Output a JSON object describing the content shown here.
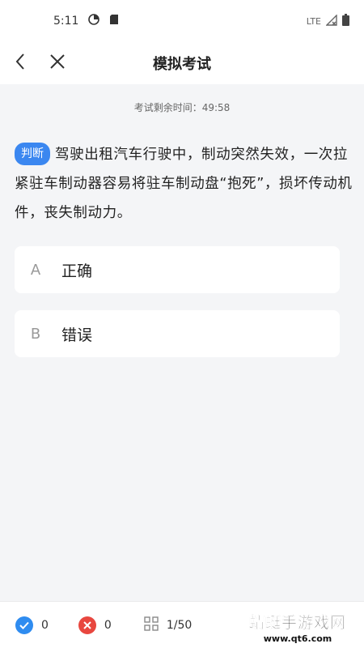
{
  "status_bar": {
    "time": "5:11",
    "network": "LTE"
  },
  "nav": {
    "title": "模拟考试"
  },
  "exam": {
    "timer_text": "考试剩余时间：49:58",
    "question_type": "判断",
    "question_text": "驾驶出租汽车行驶中，制动突然失效，一次拉紧驻车制动器容易将驻车制动盘“抱死”，损坏传动机件，丧失制动力。"
  },
  "options": [
    {
      "letter": "A",
      "text": "正确"
    },
    {
      "letter": "B",
      "text": "错误"
    }
  ],
  "bottom_bar": {
    "correct_count": "0",
    "wrong_count": "0",
    "progress": "1/50",
    "correct_color": "#2f8cf0",
    "wrong_color": "#e8473f"
  },
  "watermark": {
    "title": "蜻蜓手游戏网",
    "url": "www.qt6.com"
  },
  "icons": [
    "data-saver-icon",
    "sd-card-icon",
    "signal-icon",
    "battery-icon",
    "back-arrow-icon",
    "close-icon",
    "check-icon",
    "cross-icon",
    "grid-icon"
  ]
}
